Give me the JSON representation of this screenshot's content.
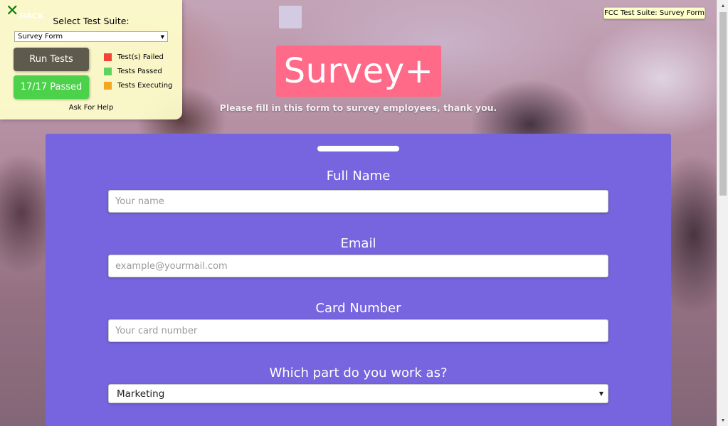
{
  "header": {
    "logo": "Survey+",
    "subtitle": "Please fill in this form to survey employees, thank you."
  },
  "form": {
    "full_name": {
      "label": "Full Name",
      "placeholder": "Your name"
    },
    "email": {
      "label": "Email",
      "placeholder": "example@yourmail.com"
    },
    "card_number": {
      "label": "Card Number",
      "placeholder": "Your card number"
    },
    "department": {
      "label": "Which part do you work as?",
      "selected": "Marketing"
    }
  },
  "fcc_panel": {
    "hack_text": "HACK",
    "select_label": "Select Test Suite:",
    "selected_suite": "Survey Form",
    "run_button": "Run Tests",
    "result_button": "17/17 Passed",
    "legend": [
      {
        "label": "Test(s) Failed",
        "color": "#f34236"
      },
      {
        "label": "Tests Passed",
        "color": "#5fd35f"
      },
      {
        "label": "Tests Executing",
        "color": "#f5a623"
      }
    ],
    "help_link": "Ask For Help",
    "suite_badge": "FCC Test Suite: Survey Form"
  },
  "colors": {
    "logo_bg": "#ff6a88",
    "form_bg": "#7665de",
    "panel_bg": "#ffffcc",
    "run_btn": "#5f5b4c",
    "passed_btn": "#4cd14a"
  },
  "icons": {
    "close": "close-icon",
    "dropdown": "chevron-down-icon"
  }
}
